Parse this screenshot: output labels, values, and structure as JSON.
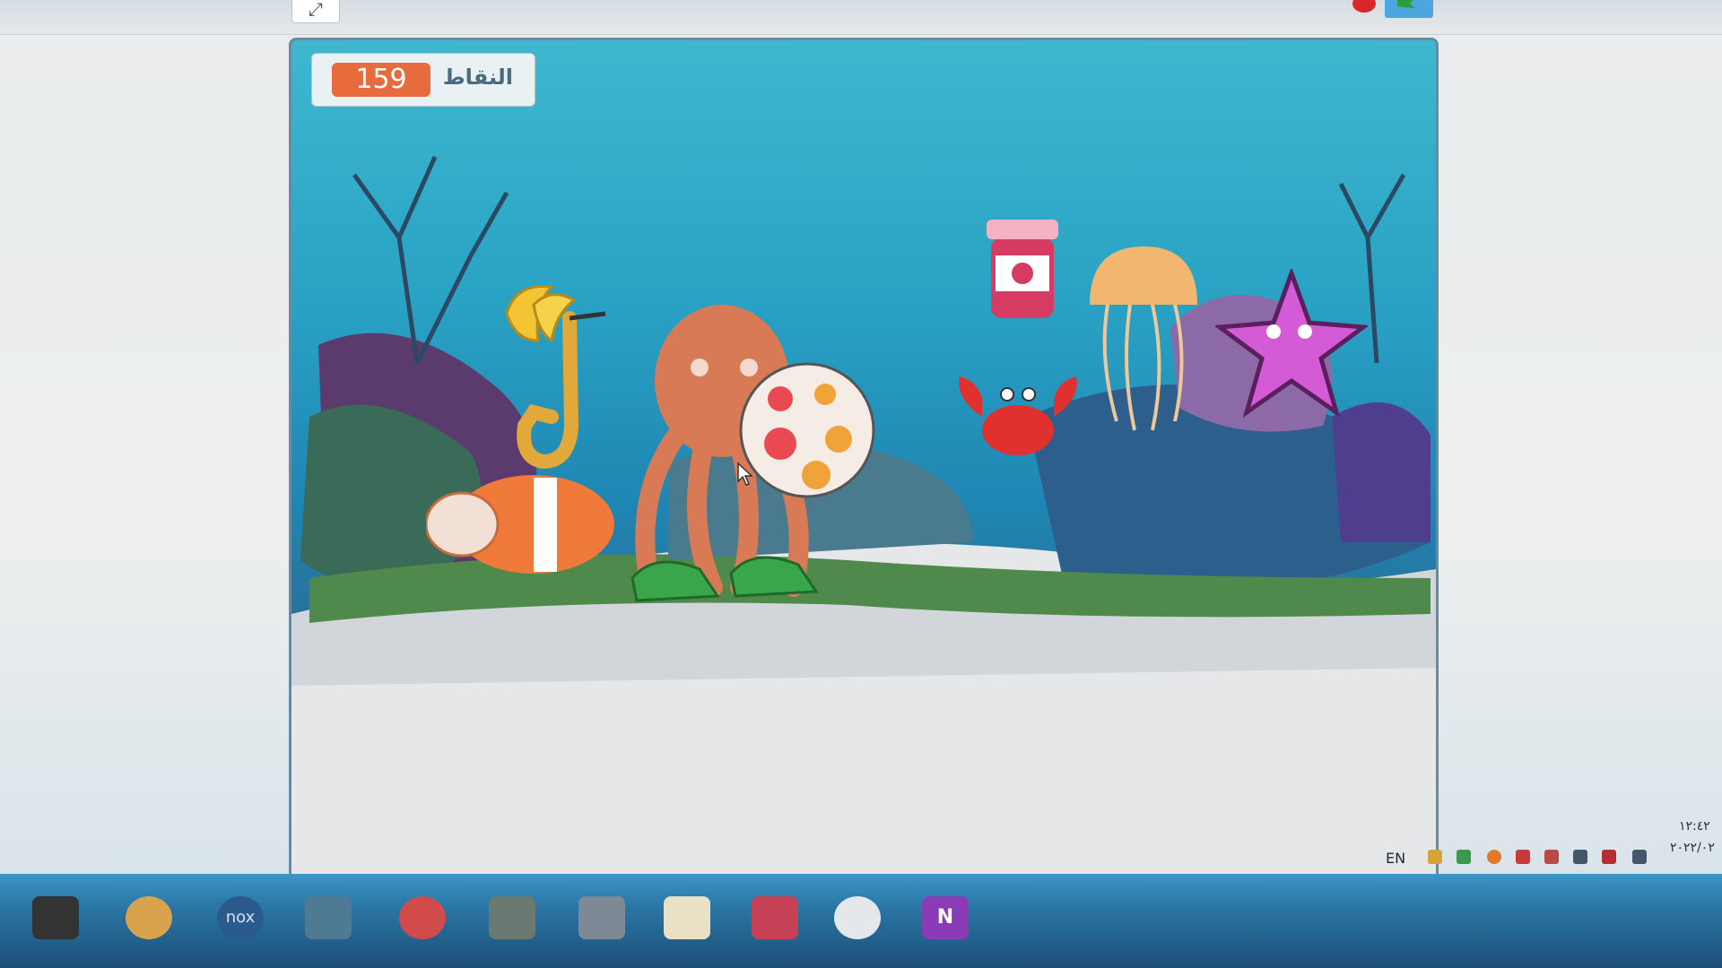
{
  "editor": {
    "fullscreen_icon": "fullscreen-icon",
    "stop_icon": "stop-sign-icon",
    "green_flag_icon": "green-flag-icon"
  },
  "stage": {
    "score_label": "النقاط",
    "score_value": "159",
    "sprites": [
      "banana",
      "saxophone",
      "clownfish",
      "octopus",
      "ball",
      "shoes",
      "jam-jar",
      "crab",
      "jellyfish",
      "starfish"
    ]
  },
  "taskbar": {
    "apps": [
      "video-player-icon",
      "paint-icon",
      "nox-icon",
      "monitor-icon",
      "angry-birds-icon",
      "settings-icon",
      "tools-icon",
      "folder-icon",
      "shield-icon",
      "chrome-icon",
      "onenote-icon"
    ],
    "nox_label": "nox",
    "onenote_label": "N",
    "language": "EN",
    "clock_time": "١٢:٤٢",
    "clock_date": "٢٠٢٢/٠٢"
  },
  "colors": {
    "score_value_bg": "#e86b3d",
    "stage_water": "#2aa3c5",
    "taskbar": "#2c7aa9"
  }
}
